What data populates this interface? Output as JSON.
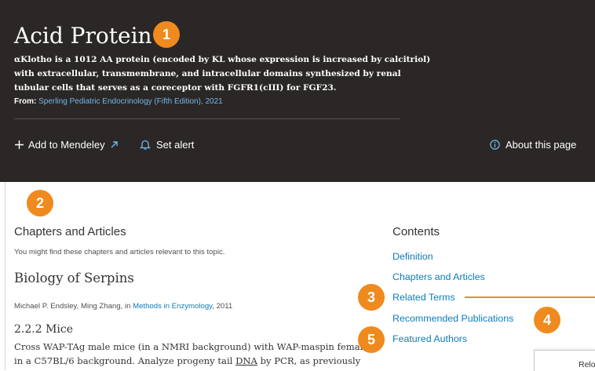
{
  "header": {
    "title": "Acid Protein",
    "description_lines": [
      "αKlotho is a 1012 AA protein (encoded by KL whose expression is increased by calcitriol)",
      "with extracellular, transmembrane, and intracellular domains synthesized by renal",
      "tubular cells that serves as a coreceptor with FGFR1(cIII) for FGF23."
    ],
    "source_prefix": "From:",
    "source_link": "Sperling Pediatric Endocrinology (Fifth Edition), 2021"
  },
  "actions": {
    "add_to_mendeley": "Add to Mendeley",
    "set_alert": "Set alert",
    "about_page": "About this page"
  },
  "main": {
    "section_heading": "Chapters and Articles",
    "section_subtitle": "You might find these chapters and articles relevant to this topic.",
    "article": {
      "title": "Biology of Serpins",
      "authors": "Michael P. Endsley, Ming Zhang, in",
      "source_link": "Methods in Enzymology",
      "year": ", 2011",
      "subsection": "2.2.2 Mice",
      "excerpt_line1": "Cross WAP-TAg male mice (in a NMRI background) with WAP-maspin female mic",
      "excerpt_line2_start": "in a C57BL/6 background. Analyze progeny tail",
      "excerpt_underlined": "DNA",
      "excerpt_line2_end": "by PCR, as previously"
    }
  },
  "contents": {
    "heading": "Contents",
    "links": [
      "Definition",
      "Chapters and Articles",
      "Related Terms",
      "Recommended Publications",
      "Featured Authors"
    ]
  },
  "annotations": {
    "badges": [
      "1",
      "2",
      "3",
      "4",
      "5"
    ],
    "accent_color": "#ef8a1e"
  },
  "floating_panel": {
    "label": "Relo"
  },
  "colors": {
    "hero_background": "#2b2726",
    "link": "#0c7dbb",
    "hero_link": "#6fb9e8"
  }
}
